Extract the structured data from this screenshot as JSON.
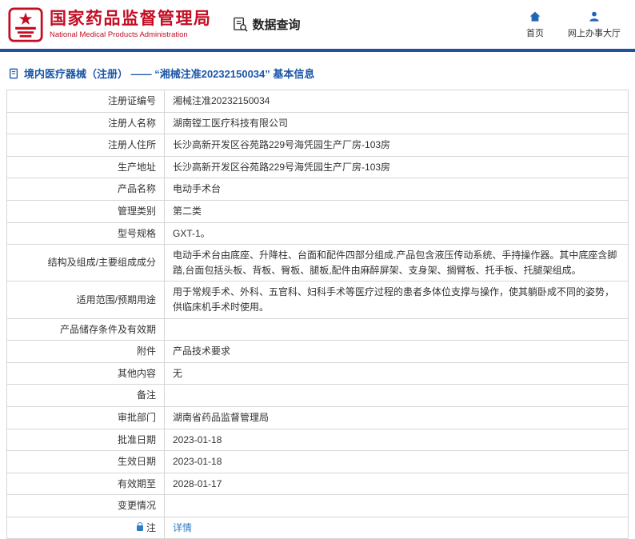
{
  "colors": {
    "brand_red": "#c30d23",
    "bar_blue": "#2050a0",
    "breadcrumb_blue": "#1a56a8",
    "link_blue": "#2f7bc4"
  },
  "header": {
    "agency_cn": "国家药品监督管理局",
    "agency_en": "National Medical Products Administration",
    "data_query": "数据查询",
    "nav": [
      {
        "label": "首页",
        "icon": "home-icon"
      },
      {
        "label": "网上办事大厅",
        "icon": "person-icon"
      }
    ]
  },
  "breadcrumb": {
    "text": "境内医疗器械（注册） ——  “湘械注准20232150034”  基本信息"
  },
  "table": {
    "rows": [
      {
        "label": "注册证编号",
        "value": "湘械注准20232150034"
      },
      {
        "label": "注册人名称",
        "value": "湖南镗工医疗科技有限公司"
      },
      {
        "label": "注册人住所",
        "value": "长沙高新开发区谷苑路229号海凭园生产厂房-103房"
      },
      {
        "label": "生产地址",
        "value": "长沙高新开发区谷苑路229号海凭园生产厂房-103房"
      },
      {
        "label": "产品名称",
        "value": "电动手术台"
      },
      {
        "label": "管理类别",
        "value": "第二类"
      },
      {
        "label": "型号规格",
        "value": "GXT-1。"
      },
      {
        "label": "结构及组成/主要组成成分",
        "value": "电动手术台由底座、升降柱、台面和配件四部分组成.产品包含液压传动系统、手持操作器。其中底座含脚踏,台面包括头板、背板、臀板、腿板,配件由麻醉屏架、支身架、搁臂板、托手板、托腿架组成。"
      },
      {
        "label": "适用范围/预期用途",
        "value": "用于常规手术、外科、五官科、妇科手术等医疗过程的患者多体位支撑与操作，使其躺卧成不同的姿势，供临床机手术时使用。"
      },
      {
        "label": "产品储存条件及有效期",
        "value": ""
      },
      {
        "label": "附件",
        "value": "产品技术要求"
      },
      {
        "label": "其他内容",
        "value": "无"
      },
      {
        "label": "备注",
        "value": ""
      },
      {
        "label": "审批部门",
        "value": "湖南省药品监督管理局"
      },
      {
        "label": "批准日期",
        "value": "2023-01-18"
      },
      {
        "label": "生效日期",
        "value": "2023-01-18"
      },
      {
        "label": "有效期至",
        "value": "2028-01-17"
      },
      {
        "label": "变更情况",
        "value": ""
      },
      {
        "label": "注",
        "label_icon": "lock-icon",
        "value": "详情",
        "link": true
      }
    ]
  }
}
